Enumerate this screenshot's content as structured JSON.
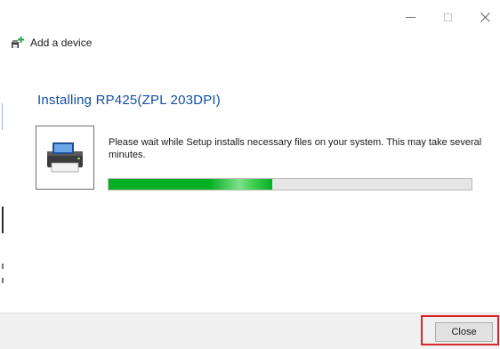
{
  "window": {
    "title": "Add a device",
    "title_icon": "add-printer-icon",
    "controls": [
      "minimize-icon",
      "maximize-icon",
      "close-icon"
    ]
  },
  "main": {
    "heading": "Installing RP425(ZPL 203DPI)",
    "message": "Please wait while Setup installs necessary files on your system. This may take several minutes.",
    "device_icon": "printer-icon",
    "progress_fraction": 0.45
  },
  "footer": {
    "close_label": "Close"
  },
  "colors": {
    "heading": "#0f4fa6",
    "progress": "#06b025",
    "highlight": "#d9262b"
  }
}
